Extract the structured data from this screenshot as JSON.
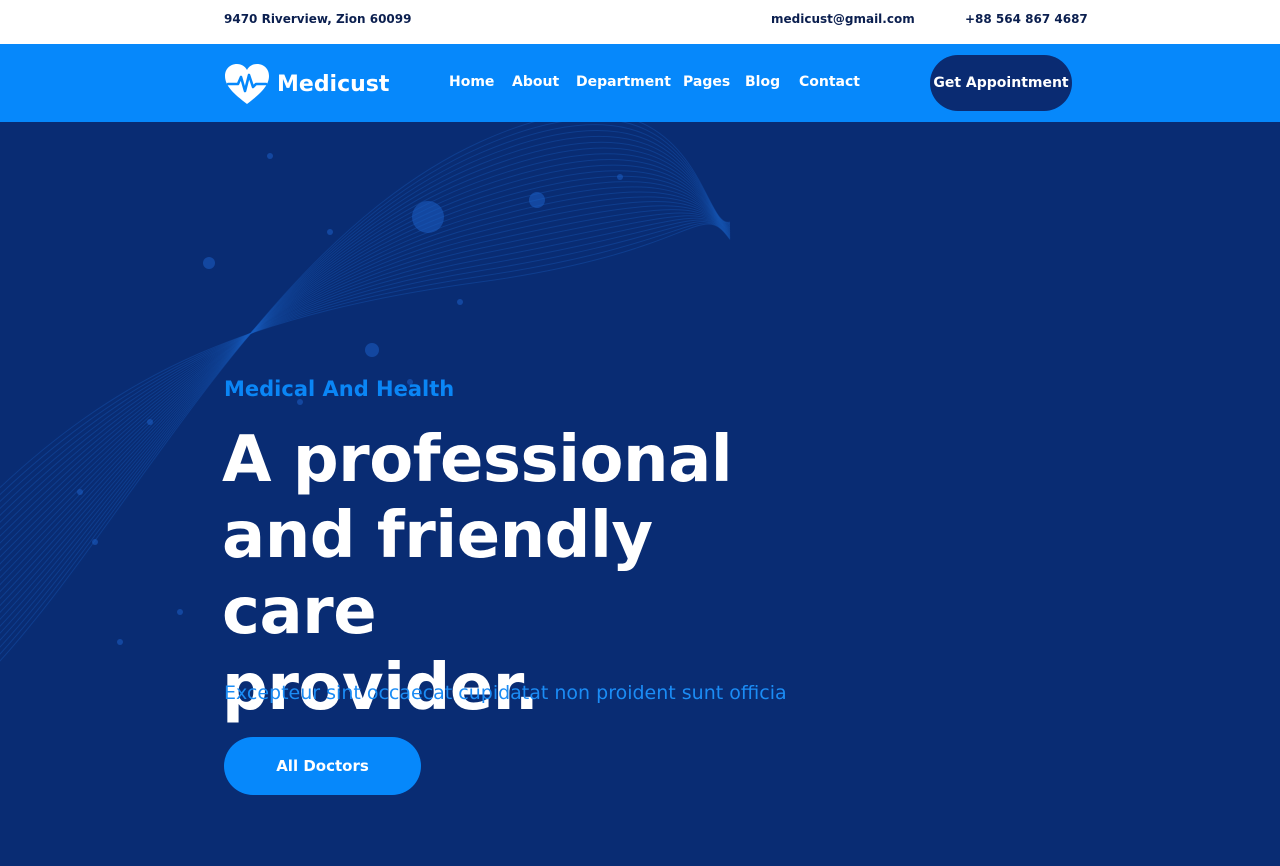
{
  "topbar": {
    "address": "9470 Riverview, Zion 60099",
    "email": "medicust@gmail.com",
    "phone": "+88 564 867 4687"
  },
  "navbar": {
    "logo_icon": "heart-pulse-icon",
    "brand": "Medicust",
    "links": [
      "Home",
      "About",
      "Department",
      "Pages",
      "Blog",
      "Contact"
    ],
    "cta": "Get Appointment"
  },
  "hero": {
    "eyebrow": "Medical And Health",
    "headline_line1": "A professional",
    "headline_line2": "and friendly care",
    "headline_line3": "provider.",
    "subtitle": "Excepteur sint occaecat cupidatat non proident sunt officia",
    "button": "All Doctors"
  },
  "colors": {
    "primary_blue": "#0688fb",
    "navy": "#092c73",
    "white": "#ffffff"
  }
}
